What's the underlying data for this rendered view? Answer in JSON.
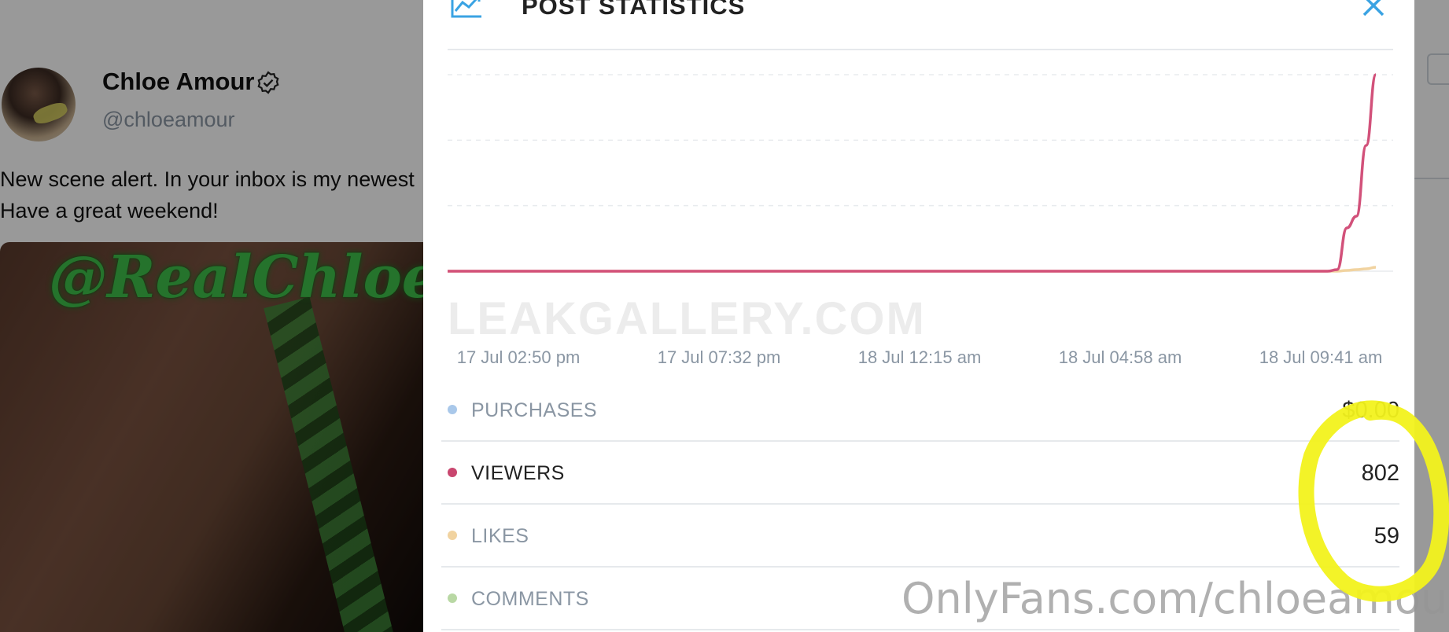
{
  "background_post": {
    "author_name": "Chloe Amour",
    "author_handle": "@chloeamour",
    "post_text": "New scene alert. In your inbox is my newest\nHave a great weekend!",
    "media_watermark": "@RealChloeAm"
  },
  "modal": {
    "title": "POST STATISTICS",
    "icons": {
      "header": "chart-line-icon",
      "close": "close-icon"
    },
    "x_labels": [
      "17 Jul 02:50 pm",
      "17 Jul 07:32 pm",
      "18 Jul 12:15 am",
      "18 Jul 04:58 am",
      "18 Jul 09:41 am"
    ],
    "stats": [
      {
        "label": "PURCHASES",
        "value": "$0.00",
        "color": "#a9c8ea",
        "label_color": "#8a96a3"
      },
      {
        "label": "VIEWERS",
        "value": "802",
        "color": "#c9466f",
        "label_color": "#222222"
      },
      {
        "label": "LIKES",
        "value": "59",
        "color": "#f1d3a0",
        "label_color": "#8a96a3"
      },
      {
        "label": "COMMENTS",
        "value": "",
        "color": "#b9d8a4",
        "label_color": "#8a96a3"
      }
    ]
  },
  "chart_data": {
    "type": "line",
    "x": [
      "17 Jul 02:50 pm",
      "17 Jul 07:32 pm",
      "18 Jul 12:15 am",
      "18 Jul 04:58 am",
      "18 Jul 09:41 am"
    ],
    "series": [
      {
        "name": "VIEWERS",
        "color": "#d2517a",
        "values": [
          0,
          0,
          0,
          0,
          0,
          0,
          0,
          0,
          0,
          0,
          0,
          0,
          0,
          0,
          0,
          0,
          0,
          0,
          0,
          0,
          0,
          0,
          0,
          0,
          0,
          0,
          0,
          0,
          0,
          0,
          0,
          0,
          0,
          0,
          0,
          0,
          0,
          0,
          0,
          0,
          0,
          0,
          0,
          0,
          0,
          0,
          0,
          0,
          0,
          0,
          0,
          0,
          0,
          0,
          0,
          0,
          0,
          0,
          0,
          0,
          0,
          0,
          0,
          0,
          0,
          0,
          0,
          0,
          0,
          0,
          0,
          0,
          0,
          0,
          0,
          0,
          0,
          0,
          0,
          0,
          0,
          0,
          0,
          0,
          0,
          0,
          0,
          0,
          0,
          0,
          0,
          0,
          2,
          55,
          70,
          160,
          250
        ]
      },
      {
        "name": "LIKES",
        "color": "#f1d3a0",
        "values": [
          0,
          0,
          0,
          0,
          0,
          0,
          0,
          0,
          0,
          0,
          0,
          0,
          0,
          0,
          0,
          0,
          0,
          0,
          0,
          0,
          0,
          0,
          0,
          0,
          0,
          0,
          0,
          0,
          0,
          0,
          0,
          0,
          0,
          0,
          0,
          0,
          0,
          0,
          0,
          0,
          0,
          0,
          0,
          0,
          0,
          0,
          0,
          0,
          0,
          0,
          0,
          0,
          0,
          0,
          0,
          0,
          0,
          0,
          0,
          0,
          0,
          0,
          0,
          0,
          0,
          0,
          0,
          0,
          0,
          0,
          0,
          0,
          0,
          0,
          0,
          0,
          0,
          0,
          0,
          0,
          0,
          0,
          0,
          0,
          0,
          0,
          0,
          0,
          0,
          0,
          0,
          0,
          0,
          1,
          2,
          3,
          5
        ]
      }
    ],
    "ylim": [
      0,
      250
    ],
    "grid": true
  },
  "watermarks": {
    "leak": "LEAKGALLERY.COM",
    "onlyfans": "OnlyFans.com/chloeamour"
  }
}
